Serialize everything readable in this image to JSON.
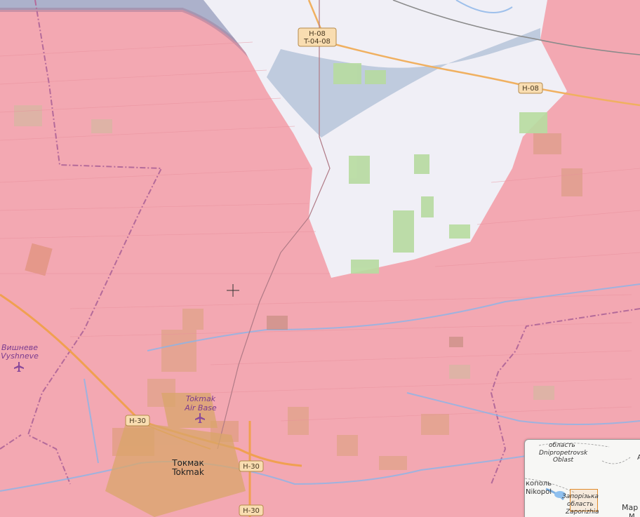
{
  "map": {
    "title": "",
    "colors": {
      "occupied": "#f3a8b2",
      "contested": "#9fb3cf",
      "free": "#f0eff6",
      "fields": "#b7dba0",
      "roads": "#f0a050",
      "water": "#8ab4e8",
      "boundary": "#b46a9a"
    },
    "road_shields": {
      "h08_top_line1": "H-08",
      "h08_top_line2": "T-04-08",
      "h08_right": "H-08",
      "h30_left": "H-30",
      "h30_mid": "H-30",
      "h30_bottom": "H-30"
    },
    "places": {
      "vyshneve_cyr": "Вишневе",
      "vyshneve_lat": "Vyshneve",
      "airbase_line1": "Tokmak",
      "airbase_line2": "Air Base",
      "tokmak_cyr": "Токмак",
      "tokmak_lat": "Tokmak"
    },
    "icons": {
      "airport": "airplane-icon",
      "crosshair": "crosshair-icon"
    }
  },
  "minimap": {
    "oblast_top": "область",
    "dnipro_line1": "Dnipropetrovsk",
    "dnipro_line2": "Oblast",
    "nikopol_cyr": "кополь",
    "nikopol_lat": "Nikopol",
    "zap_line1": "Запорізька",
    "zap_line2": "область",
    "zap_line3": "Zaporizhia",
    "mar": "Мар",
    "corner_a": "А",
    "corner_m": "М"
  }
}
